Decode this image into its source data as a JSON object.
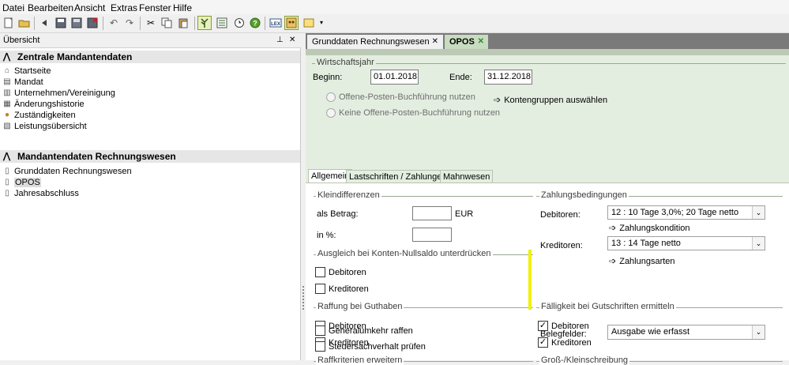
{
  "menu": [
    "Datei",
    "Bearbeiten",
    "Ansicht",
    "Extras",
    "Fenster",
    "Hilfe"
  ],
  "toolbar_icons": [
    "new-icon",
    "open-icon",
    "back-icon",
    "save-icon",
    "save-all-icon",
    "close-doc-icon",
    "undo-icon",
    "redo-icon",
    "cut-icon",
    "copy-icon",
    "paste-icon",
    "tree-icon",
    "list-icon",
    "clock-icon",
    "help-icon",
    "lex-icon",
    "mask-icon",
    "note-icon",
    "overflow-icon"
  ],
  "toolbar": {
    "lex_label": "LEX"
  },
  "overview": {
    "title": "Übersicht",
    "pin_glyph": "⊥",
    "close_glyph": "✕",
    "section1": {
      "title": "Zentrale Mandantendaten",
      "items": [
        "Startseite",
        "Mandat",
        "Unternehmen/Vereinigung",
        "Änderungshistorie",
        "Zuständigkeiten",
        "Leistungsübersicht"
      ]
    },
    "section2": {
      "title": "Mandantendaten Rechnungswesen",
      "items": [
        "Grunddaten Rechnungswesen",
        "OPOS",
        "Jahresabschluss"
      ],
      "selected": "OPOS"
    }
  },
  "tabs": [
    {
      "label": "Grunddaten Rechnungswesen",
      "close": "✕",
      "active": false
    },
    {
      "label": "OPOS",
      "close": "✕",
      "active": true
    }
  ],
  "wirtschaftsjahr": {
    "title": "Wirtschaftsjahr",
    "begin_label": "Beginn:",
    "begin_value": "01.01.2018",
    "end_label": "Ende:",
    "end_value": "31.12.2018",
    "radio1": "Offene-Posten-Buchführung nutzen",
    "radio2": "Keine Offene-Posten-Buchführung nutzen",
    "kontengruppen": "Kontengruppen auswählen"
  },
  "subtabs": [
    "Allgemein",
    "Lastschriften / Zahlungen",
    "Mahnwesen"
  ],
  "kleindifferenzen": {
    "title": "Kleindifferenzen",
    "betrag_label": "als Betrag:",
    "betrag_value": "",
    "currency": "EUR",
    "prozent_label": "in %:",
    "prozent_value": ""
  },
  "ausgleich": {
    "title": "Ausgleich bei Konten-Nullsaldo unterdrücken",
    "debitoren": "Debitoren",
    "kreditoren": "Kreditoren"
  },
  "raffung": {
    "title": "Raffung bei Guthaben",
    "debitoren": "Debitoren",
    "kreditoren": "Kreditoren"
  },
  "raffkriterien": {
    "title": "Raffkriterien erweitern",
    "opt1": "Generalumkehr raffen",
    "opt2": "Steuersachverhalt prüfen"
  },
  "zahlungsbedingungen": {
    "title": "Zahlungsbedingungen",
    "debitoren_label": "Debitoren:",
    "debitoren_value": "12 : 10 Tage 3,0%; 20 Tage netto",
    "zahlungskondition": "Zahlungskondition",
    "kreditoren_label": "Kreditoren:",
    "kreditoren_value": "13 : 14 Tage netto",
    "zahlungsarten": "Zahlungsarten"
  },
  "faelligkeit": {
    "title": "Fälligkeit bei Gutschriften ermitteln",
    "debitoren": "Debitoren",
    "kreditoren": "Kreditoren",
    "checked": true
  },
  "gross": {
    "title": "Groß-/Kleinschreibung",
    "belegfelder_label": "Belegfelder:",
    "belegfelder_value": "Ausgabe wie erfasst"
  },
  "glyphs": {
    "arrow": "➩",
    "check": "✓",
    "chevron_down": "⌄",
    "collapse": "⋀"
  },
  "colors": {
    "tabstrip": "#7a7a7a",
    "content_bg": "#e4eee0",
    "active_tab": "#c8dcc0",
    "active_tab_close": "#2e8b2e",
    "highlight_mark": "#f0f000"
  }
}
